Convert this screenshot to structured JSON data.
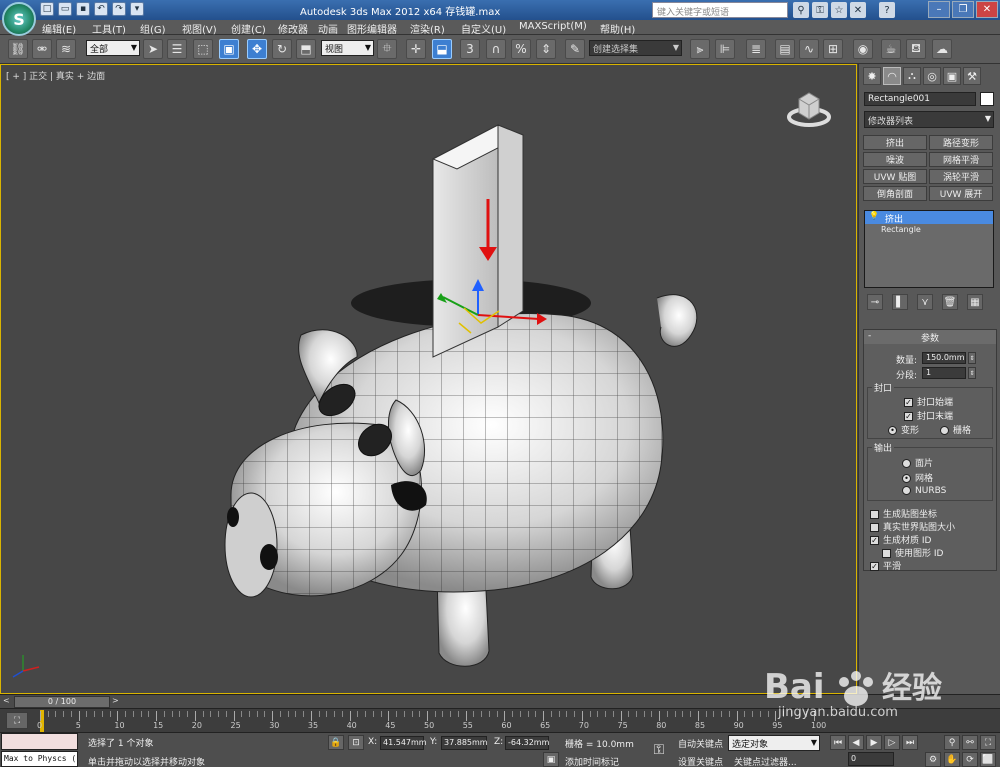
{
  "titlebar": {
    "title": "Autodesk 3ds Max  2012 x64      存钱罐.max",
    "search_placeholder": "键入关键字或短语",
    "logo": "S"
  },
  "menu": [
    "编辑(E)",
    "工具(T)",
    "组(G)",
    "视图(V)",
    "创建(C)",
    "修改器",
    "动画",
    "图形编辑器",
    "渲染(R)",
    "自定义(U)",
    "MAXScript(M)",
    "帮助(H)"
  ],
  "toolbar": {
    "selection_filter": "全部",
    "ref_coord": "视图",
    "named_selection": "创建选择集"
  },
  "viewport": {
    "label": "[ + ] 正交 | 真实 + 边面"
  },
  "panel": {
    "object_name": "Rectangle001",
    "modifier_list": "修改器列表",
    "modifier_buttons": [
      "挤出",
      "路径变形",
      "噪波",
      "网格平滑",
      "UVW 贴图",
      "涡轮平滑",
      "倒角剖面",
      "UVW 展开"
    ],
    "stack": [
      "挤出",
      "Rectangle"
    ],
    "params": {
      "title": "参数",
      "amount_label": "数量:",
      "amount_value": "150.0mm",
      "segments_label": "分段:",
      "segments_value": "1",
      "capping_title": "封口",
      "cap_start": "封口始端",
      "cap_end": "封口末端",
      "morph": "变形",
      "grid": "栅格",
      "output_title": "输出",
      "patch": "面片",
      "mesh": "网格",
      "nurbs": "NURBS",
      "gen_map_coords": "生成贴图坐标",
      "real_world_map": "真实世界贴图大小",
      "gen_mat_ids": "生成材质 ID",
      "use_shape_ids": "使用图形 ID",
      "smooth": "平滑"
    }
  },
  "timeline": {
    "frame_range": "0 / 100",
    "ruler_labels": [
      "0",
      "5",
      "10",
      "15",
      "20",
      "25",
      "30",
      "35",
      "40",
      "45",
      "50",
      "55",
      "60",
      "65",
      "70",
      "75",
      "80",
      "85",
      "90",
      "95",
      "100"
    ]
  },
  "status": {
    "maxscript": "Max to Physcs (",
    "selected": "选择了 1 个对象",
    "prompt": "单击并拖动以选择并移动对象",
    "x_label": "X:",
    "x_value": "41.547mm",
    "y_label": "Y:",
    "y_value": "37.885mm",
    "z_label": "Z:",
    "z_value": "-64.32mm",
    "grid": "栅格 = 10.0mm",
    "add_time_tag": "添加时间标记",
    "auto_key": "自动关键点",
    "set_key": "设置关键点",
    "selected_obj": "选定对象",
    "key_filters": "关键点过滤器...",
    "frame": "0"
  },
  "colors": {
    "viewport_border": "#d9b400",
    "active_tool": "#3d7fd1",
    "arrow": "#e01010"
  }
}
